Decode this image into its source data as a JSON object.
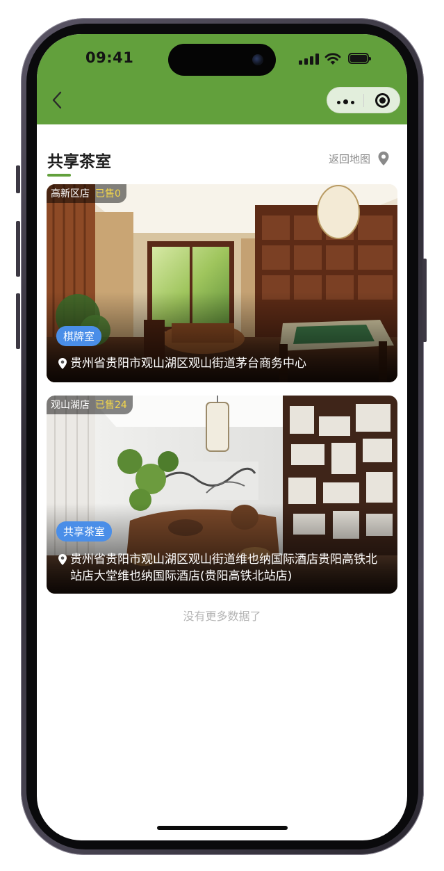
{
  "status_bar": {
    "time": "09:41"
  },
  "nav": {
    "back_icon": "chevron-left-icon",
    "more_icon": "more-dots-icon",
    "close_icon": "target-close-icon",
    "bar_color": "#62a03c"
  },
  "page": {
    "title": "共享茶室",
    "back_to_map_label": "返回地图",
    "back_to_map_icon": "map-pin-icon",
    "accent": "#62a03c"
  },
  "stores": [
    {
      "store_name": "高新区店",
      "sold_label": "已售0",
      "room_type": "棋牌室",
      "address": "贵州省贵阳市观山湖区观山街道茅台商务中心"
    },
    {
      "store_name": "观山湖店",
      "sold_label": "已售24",
      "room_type": "共享茶室",
      "address": "贵州省贵阳市观山湖区观山街道维也纳国际酒店贵阳高铁北站店大堂维也纳国际酒店(贵阳高铁北站店)"
    }
  ],
  "footer": {
    "no_more_text": "没有更多数据了"
  },
  "colors": {
    "badge_blue": "#4a8ee8",
    "sold_yellow": "#f2d64b"
  }
}
